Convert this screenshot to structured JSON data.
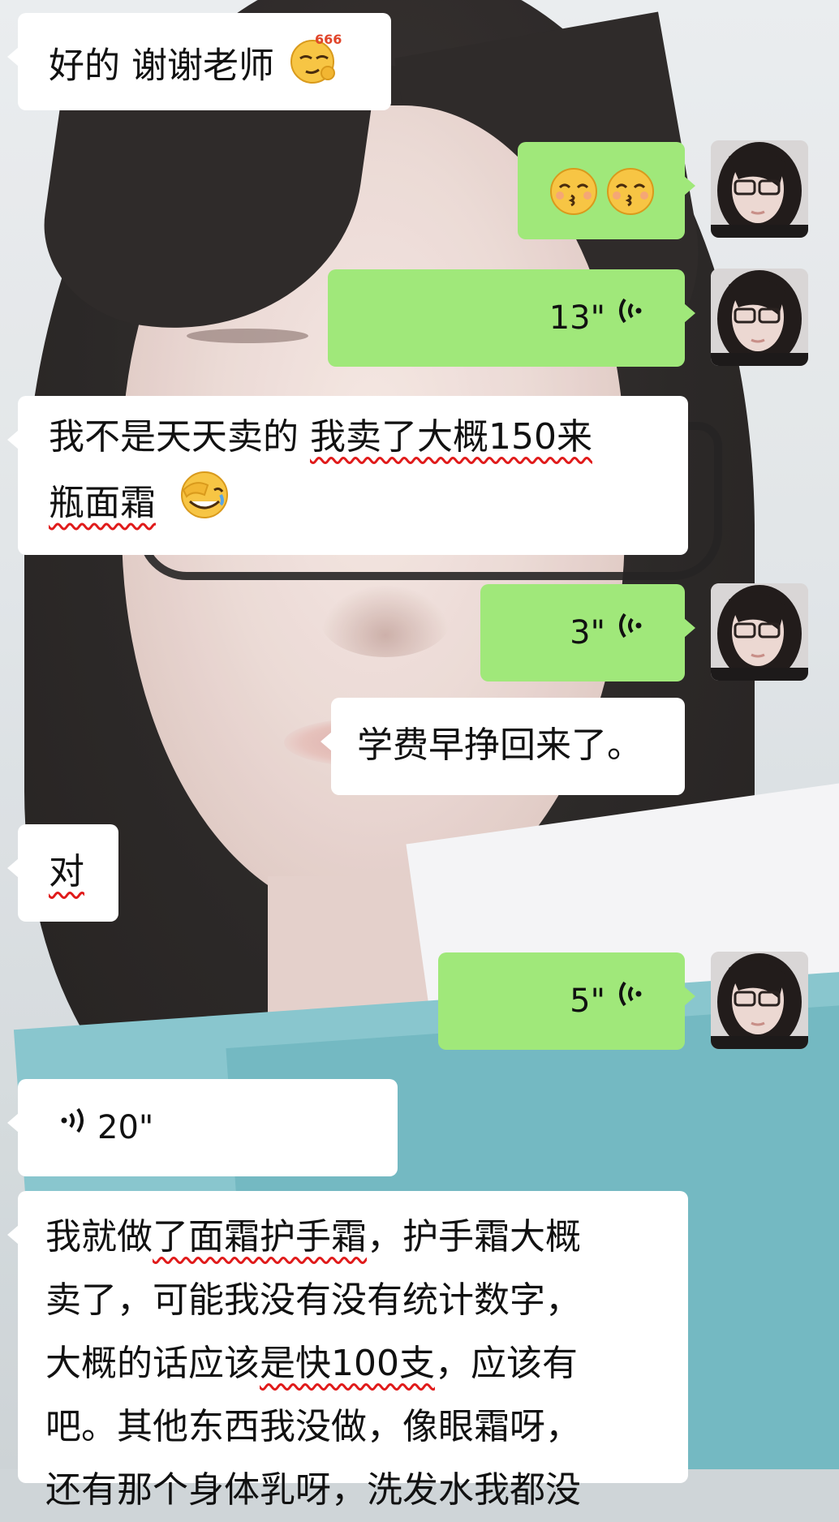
{
  "background": {
    "subject": "selfie photo wallpaper",
    "shirt_color": "#f3f4f6",
    "folder_color": "#7fc2ca"
  },
  "colors": {
    "incoming_bubble": "#ffffff",
    "outgoing_bubble": "#a0e87a",
    "underline": "#e01b1b"
  },
  "messages": [
    {
      "id": "m1",
      "side": "incoming",
      "type": "text",
      "parts": [
        {
          "text": "好的 谢谢老师",
          "wavy": false
        }
      ],
      "emoji": [
        "smug-666-emoji"
      ]
    },
    {
      "id": "m2",
      "side": "outgoing",
      "type": "emoji",
      "emoji": [
        "kissing-face-emoji",
        "kissing-face-emoji"
      ]
    },
    {
      "id": "m3",
      "side": "outgoing",
      "type": "voice",
      "duration": "13\""
    },
    {
      "id": "m4",
      "side": "incoming",
      "type": "text",
      "line1": [
        {
          "text": "我不是天天卖的 ",
          "wavy": false
        },
        {
          "text": "我卖了大概150来",
          "wavy": true
        }
      ],
      "line2": [
        {
          "text": "瓶面霜",
          "wavy": true
        }
      ],
      "emoji": [
        "facepalm-laughing-emoji"
      ]
    },
    {
      "id": "m5",
      "side": "outgoing",
      "type": "voice",
      "duration": "3\""
    },
    {
      "id": "m6",
      "side": "outgoing",
      "type": "text",
      "text": "学费早挣回来了。"
    },
    {
      "id": "m7",
      "side": "incoming",
      "type": "text",
      "text": "对",
      "wavy": true
    },
    {
      "id": "m8",
      "side": "outgoing",
      "type": "voice",
      "duration": "5\""
    },
    {
      "id": "m9",
      "side": "incoming",
      "type": "voice",
      "duration": "20\""
    },
    {
      "id": "m10",
      "side": "incoming",
      "type": "text",
      "lines": [
        [
          {
            "text": "我就做",
            "wavy": false
          },
          {
            "text": "了面霜护手霜",
            "wavy": true
          },
          {
            "text": "，护手霜大概",
            "wavy": false
          }
        ],
        [
          {
            "text": "卖了，可能我没有没有统计数字，",
            "wavy": false
          }
        ],
        [
          {
            "text": "大概的话应该",
            "wavy": false
          },
          {
            "text": "是快100支",
            "wavy": true
          },
          {
            "text": "，应该有",
            "wavy": false
          }
        ],
        [
          {
            "text": "吧。其他东西我没做，像眼霜呀，",
            "wavy": false
          }
        ],
        [
          {
            "text": "还有那个身体乳呀，洗发水我都没",
            "wavy": false
          }
        ]
      ]
    }
  ],
  "avatar": {
    "description": "user-avatar"
  }
}
